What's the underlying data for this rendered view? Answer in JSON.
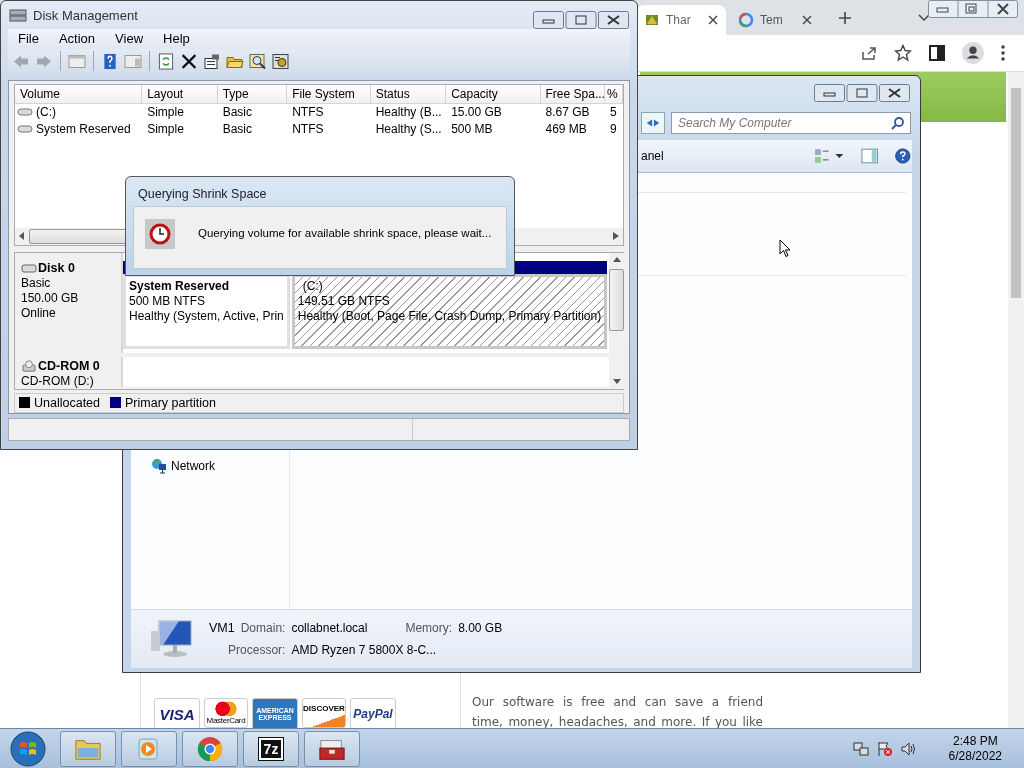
{
  "browser": {
    "tabs": [
      {
        "label": "Thar",
        "selected": true
      },
      {
        "label": "Tem",
        "selected": false
      }
    ],
    "page": {
      "payment_logos": [
        {
          "kind": "visa",
          "text": "VISA"
        },
        {
          "kind": "mastercard",
          "text": "MasterCard"
        },
        {
          "kind": "amex",
          "text": "AMERICAN EXPRESS"
        },
        {
          "kind": "discover",
          "text": "DISCOVER"
        },
        {
          "kind": "paypal",
          "text": "PayPal"
        }
      ],
      "paragraph_lines": [
        "Our software is free and can save a friend",
        "time, money, headaches, and more. If you like"
      ]
    }
  },
  "explorer": {
    "search": {
      "placeholder": "Search My Computer"
    },
    "toolbar_label": "anel",
    "nav_items": [
      {
        "label": "Network"
      }
    ],
    "details": {
      "name": "VM1",
      "fields": [
        {
          "label": "Domain:",
          "value": "collabnet.local"
        },
        {
          "label": "Memory:",
          "value": "8.00 GB"
        },
        {
          "label": "Processor:",
          "value": "AMD Ryzen 7 5800X 8-C..."
        }
      ]
    }
  },
  "disk_management": {
    "title": "Disk Management",
    "menu": [
      "File",
      "Action",
      "View",
      "Help"
    ],
    "columns": [
      "Volume",
      "Layout",
      "Type",
      "File System",
      "Status",
      "Capacity",
      "Free Spa...",
      "%"
    ],
    "rows": [
      [
        "(C:)",
        "Simple",
        "Basic",
        "NTFS",
        "Healthy (B...",
        "15.00 GB",
        "8.67 GB",
        "5"
      ],
      [
        "System Reserved",
        "Simple",
        "Basic",
        "NTFS",
        "Healthy (S...",
        "500 MB",
        "469 MB",
        "9"
      ]
    ],
    "disks": [
      {
        "name": "Disk 0",
        "kind": "disk",
        "info": [
          "Basic",
          "150.00 GB",
          "Online"
        ],
        "partitions": [
          {
            "name": "System Reserved",
            "size": "500 MB NTFS",
            "status": "Healthy (System, Active, Prin",
            "selected": false
          },
          {
            "name": "(C:)",
            "size": "149.51 GB NTFS",
            "status": "Healthy (Boot, Page File, Crash Dump, Primary Partition)",
            "selected": true
          }
        ]
      },
      {
        "name": "CD-ROM 0",
        "kind": "cdrom",
        "info": [
          "CD-ROM (D:)"
        ]
      }
    ],
    "legend": [
      {
        "label": "Unallocated",
        "color": "#000000"
      },
      {
        "label": "Primary partition",
        "color": "#000080"
      }
    ]
  },
  "dialog": {
    "title": "Querying Shrink Space",
    "message": "Querying volume for available shrink space, please wait..."
  },
  "taskbar": {
    "buttons": [
      {
        "kind": "folder"
      },
      {
        "kind": "media"
      },
      {
        "kind": "browser"
      },
      {
        "kind": "archive",
        "text": "7z"
      },
      {
        "kind": "toolbox"
      }
    ],
    "time": "2:48 PM",
    "date": "6/28/2022"
  }
}
